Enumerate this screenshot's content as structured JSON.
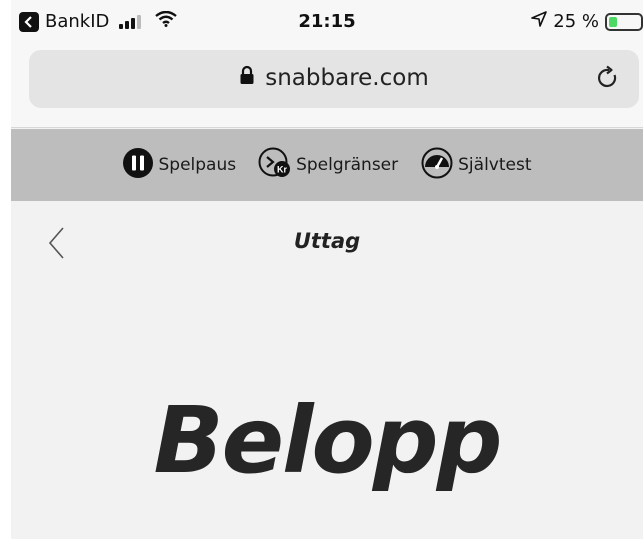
{
  "status_bar": {
    "back_app_label": "BankID",
    "time": "21:15",
    "battery_text": "25 %",
    "battery_level": 0.25
  },
  "browser": {
    "url": "snabbare.com"
  },
  "responsible_gaming": {
    "items": [
      {
        "label": "Spelpaus",
        "icon": "pause-icon"
      },
      {
        "label": "Spelgränser",
        "icon": "limits-icon"
      },
      {
        "label": "Självtest",
        "icon": "speedometer-icon"
      }
    ]
  },
  "page": {
    "title": "Uttag",
    "amount_heading": "Belopp"
  },
  "colors": {
    "battery_green": "#4cd964",
    "rg_bar_bg": "#bdbdbd",
    "page_bg": "#f2f2f2"
  }
}
